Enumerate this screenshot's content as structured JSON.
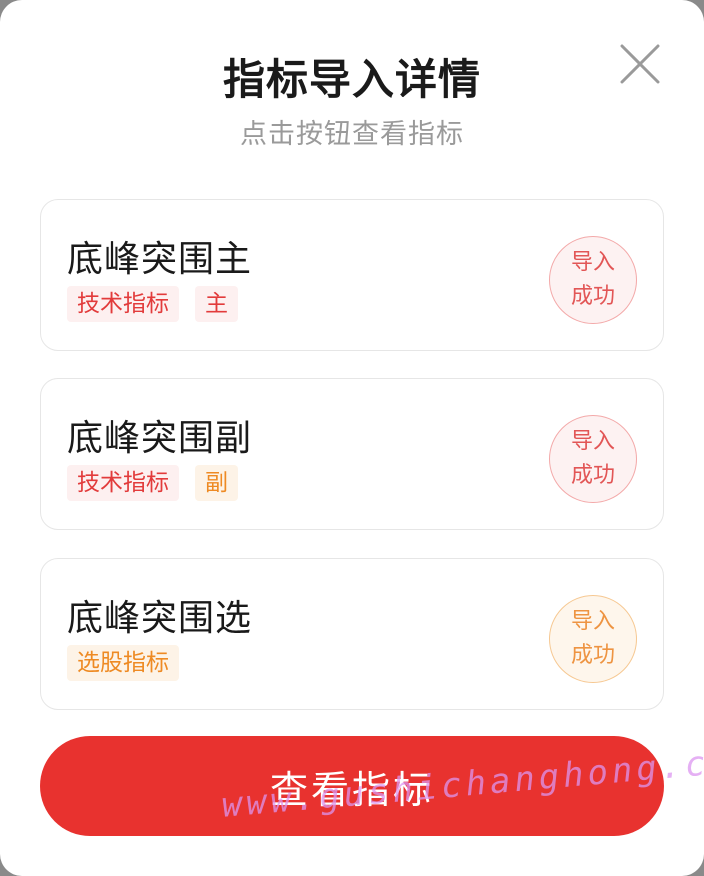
{
  "dialog": {
    "title": "指标导入详情",
    "subtitle": "点击按钮查看指标",
    "close_icon": "close-icon"
  },
  "items": [
    {
      "name": "底峰突围主",
      "tags": [
        {
          "label": "技术指标",
          "color": "#e23b3b"
        },
        {
          "label": "主",
          "color": "#e23b3b"
        }
      ],
      "status_line1": "导入",
      "status_line2": "成功",
      "status_color": "#e25656"
    },
    {
      "name": "底峰突围副",
      "tags": [
        {
          "label": "技术指标",
          "color": "#e23b3b"
        },
        {
          "label": "副",
          "color": "#ee8a23"
        }
      ],
      "status_line1": "导入",
      "status_line2": "成功",
      "status_color": "#e25656"
    },
    {
      "name": "底峰突围选",
      "tags": [
        {
          "label": "选股指标",
          "color": "#ee8a23"
        }
      ],
      "status_line1": "导入",
      "status_line2": "成功",
      "status_color": "#ee9442"
    }
  ],
  "footer": {
    "button_label": "查看指标",
    "button_color": "#e8322f"
  },
  "watermark": "www.gushichanghong.com"
}
